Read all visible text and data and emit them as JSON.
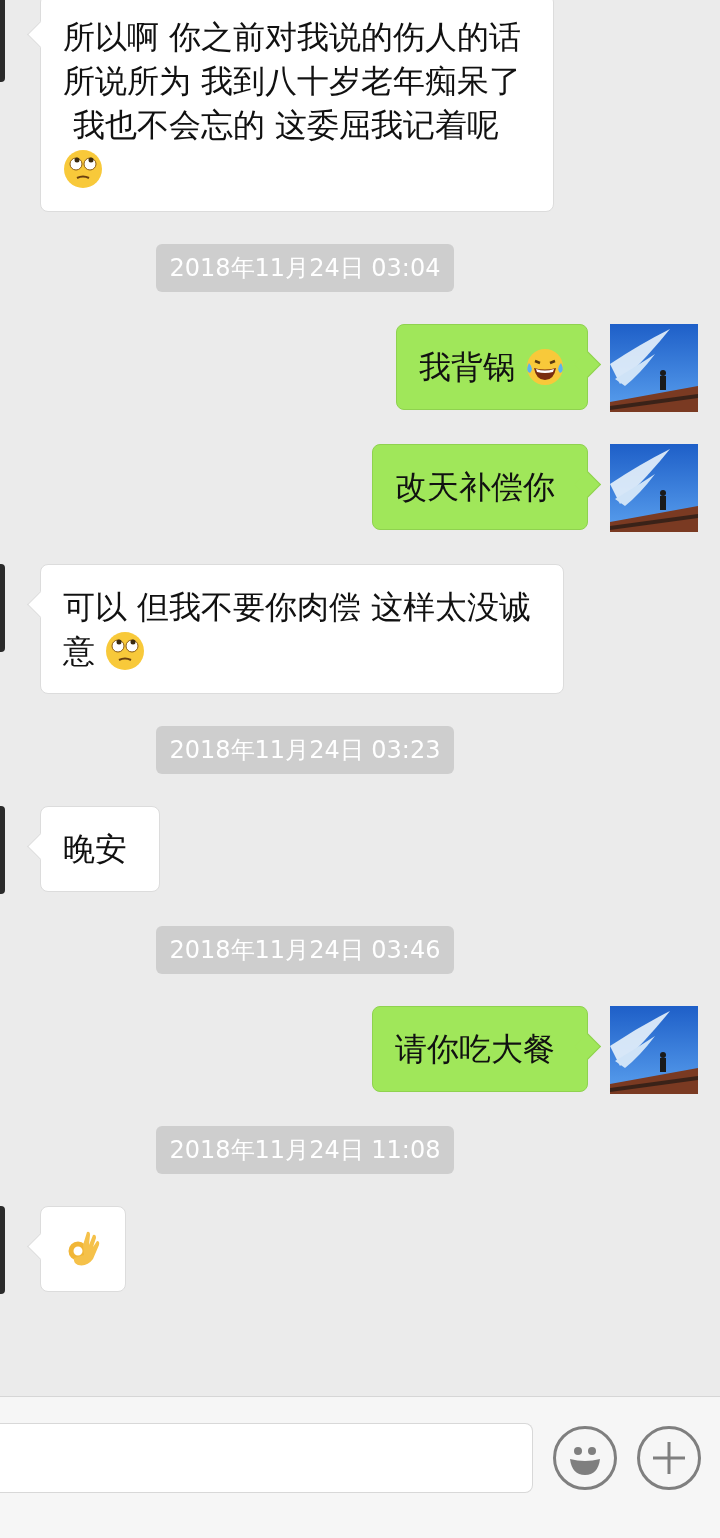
{
  "messages": [
    {
      "kind": "message",
      "from_me": false,
      "lines": [
        [
          {
            "kind": "text",
            "text": "所以啊 你之前对我说的伤人的话"
          }
        ],
        [
          {
            "kind": "text",
            "text": "所说所为 我到八十岁老年痴呆了"
          }
        ],
        [
          {
            "kind": "text",
            "text": " 我也不会忘的 这委屈我记着呢"
          }
        ],
        [
          {
            "kind": "eyeroll"
          }
        ]
      ]
    },
    {
      "kind": "time",
      "text": "2018年11月24日 03:04"
    },
    {
      "kind": "message",
      "from_me": true,
      "lines": [
        [
          {
            "kind": "text",
            "text": "我背锅"
          },
          {
            "kind": "laugh"
          }
        ]
      ]
    },
    {
      "kind": "message",
      "from_me": true,
      "lines": [
        [
          {
            "kind": "text",
            "text": "改天补偿你"
          }
        ]
      ]
    },
    {
      "kind": "message",
      "from_me": false,
      "lines": [
        [
          {
            "kind": "text",
            "text": "可以 但我不要你肉偿 这样太没诚"
          }
        ],
        [
          {
            "kind": "text",
            "text": "意"
          },
          {
            "kind": "eyeroll"
          }
        ]
      ]
    },
    {
      "kind": "time",
      "text": "2018年11月24日 03:23"
    },
    {
      "kind": "message",
      "from_me": false,
      "lines": [
        [
          {
            "kind": "text",
            "text": "晚安"
          }
        ]
      ]
    },
    {
      "kind": "time",
      "text": "2018年11月24日 03:46"
    },
    {
      "kind": "message",
      "from_me": true,
      "lines": [
        [
          {
            "kind": "text",
            "text": "请你吃大餐"
          }
        ]
      ]
    },
    {
      "kind": "time",
      "text": "2018年11月24日 11:08"
    },
    {
      "kind": "message",
      "from_me": false,
      "lines": [
        [
          {
            "kind": "okhand"
          }
        ]
      ]
    }
  ]
}
